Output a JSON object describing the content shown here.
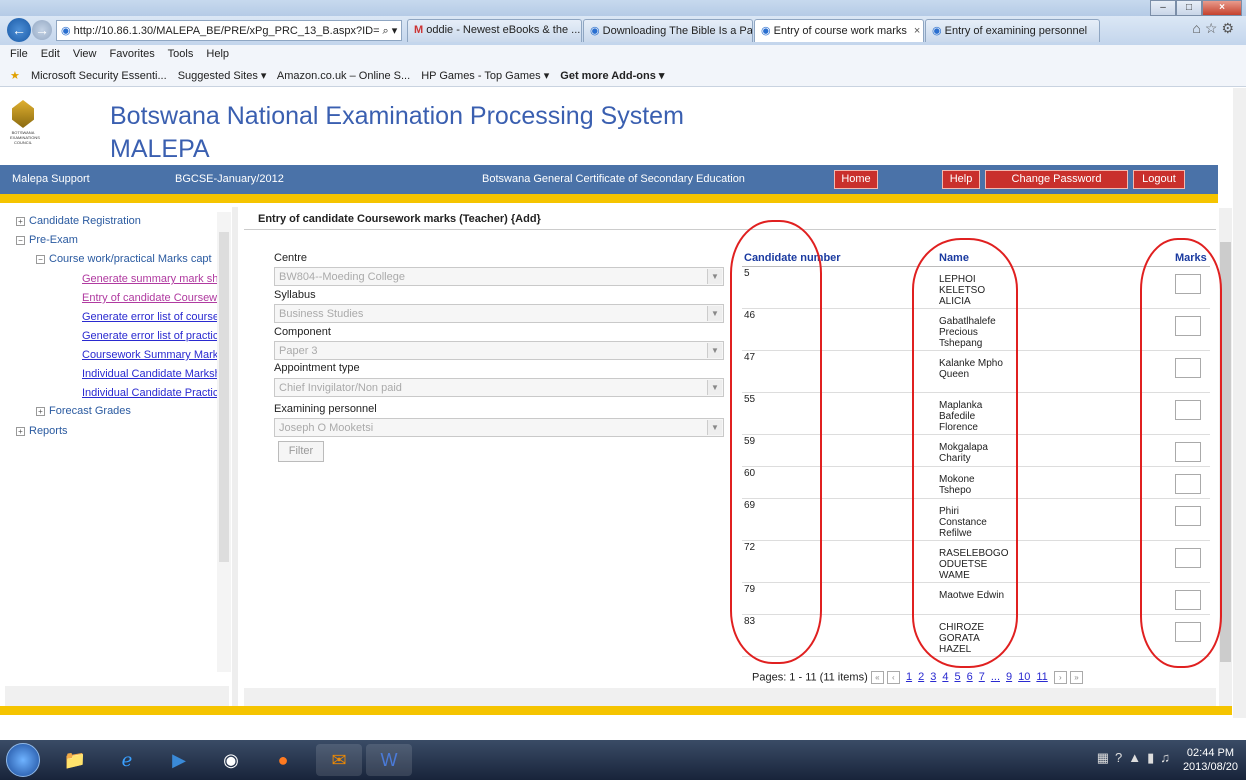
{
  "browser": {
    "address": "http://10.86.1.30/MALEPA_BE/PRE/xPg_PRC_13_B.aspx?ID= ⌕ ▾ ↻",
    "tabs": [
      {
        "label": "oddie - Newest eBooks & the ..."
      },
      {
        "label": "Downloading The Bible Is a Par..."
      },
      {
        "label": "Entry of course work marks",
        "close": "×"
      },
      {
        "label": "Entry of examining personnel"
      }
    ],
    "menu": [
      "File",
      "Edit",
      "View",
      "Favorites",
      "Tools",
      "Help"
    ],
    "favorites": [
      "Microsoft Security Essenti...",
      "Suggested Sites ▾",
      "Amazon.co.uk – Online S...",
      "HP Games - Top Games ▾",
      "Get more Add-ons ▾"
    ]
  },
  "header": {
    "title_line1": "Botswana National Examination Processing System",
    "title_line2": "MALEPA"
  },
  "topbar": {
    "support": "Malepa Support",
    "session": "BGCSE-January/2012",
    "exam": "Botswana General Certificate of Secondary Education",
    "home": "Home",
    "help": "Help",
    "change_password": "Change Password",
    "logout": "Logout"
  },
  "tree": {
    "candidate_registration": "Candidate Registration",
    "pre_exam": "Pre-Exam",
    "coursework": "Course work/practical Marks capt",
    "items": [
      "Generate summary mark she",
      "Entry of candidate Coursewo",
      "Generate error list of coursev",
      "Generate error list of practic",
      "Coursework Summary Marksh",
      "Individual Candidate Markshe",
      "Individual Candidate Practical"
    ],
    "forecast": "Forecast Grades",
    "reports": "Reports"
  },
  "panel": {
    "heading": "Entry of candidate Coursework marks (Teacher) {Add}",
    "centre_label": "Centre",
    "centre_value": "BW804--Moeding College",
    "syllabus_label": "Syllabus",
    "syllabus_value": "Business Studies",
    "component_label": "Component",
    "component_value": "Paper 3",
    "appointment_label": "Appointment type",
    "appointment_value": "Chief Invigilator/Non paid",
    "personnel_label": "Examining personnel",
    "personnel_value": "Joseph O Mooketsi",
    "filter": "Filter"
  },
  "grid": {
    "col_candidate": "Candidate number",
    "col_name": "Name",
    "col_marks": "Marks",
    "rows": [
      {
        "num": "5",
        "name": "LEPHOI KELETSO ALICIA",
        "mark": ""
      },
      {
        "num": "46",
        "name": "Gabatlhalefe Precious Tshepang",
        "mark": ""
      },
      {
        "num": "47",
        "name": "Kalanke Mpho Queen",
        "mark": ""
      },
      {
        "num": "55",
        "name": "Maplanka Bafedile Florence",
        "mark": ""
      },
      {
        "num": "59",
        "name": "Mokgalapa Charity",
        "mark": ""
      },
      {
        "num": "60",
        "name": "Mokone Tshepo",
        "mark": ""
      },
      {
        "num": "69",
        "name": "Phiri Constance Refilwe",
        "mark": ""
      },
      {
        "num": "72",
        "name": "RASELEBOGO ODUETSE WAME",
        "mark": ""
      },
      {
        "num": "79",
        "name": "Maotwe Edwin",
        "mark": ""
      },
      {
        "num": "83",
        "name": "CHIROZE GORATA HAZEL",
        "mark": ""
      }
    ]
  },
  "pager": {
    "summary": "Pages: 1 - 11 (11 items)",
    "pages": [
      "1",
      "2",
      "3",
      "4",
      "5",
      "6",
      "7",
      "...",
      "9",
      "10",
      "11"
    ]
  },
  "taskbar": {
    "time": "02:44 PM",
    "date": "2013/08/20"
  },
  "colors": {
    "brand_blue": "#4a72a8",
    "accent_yellow": "#f5c400",
    "button_red": "#c9302c",
    "annotation_red": "#e02020"
  }
}
